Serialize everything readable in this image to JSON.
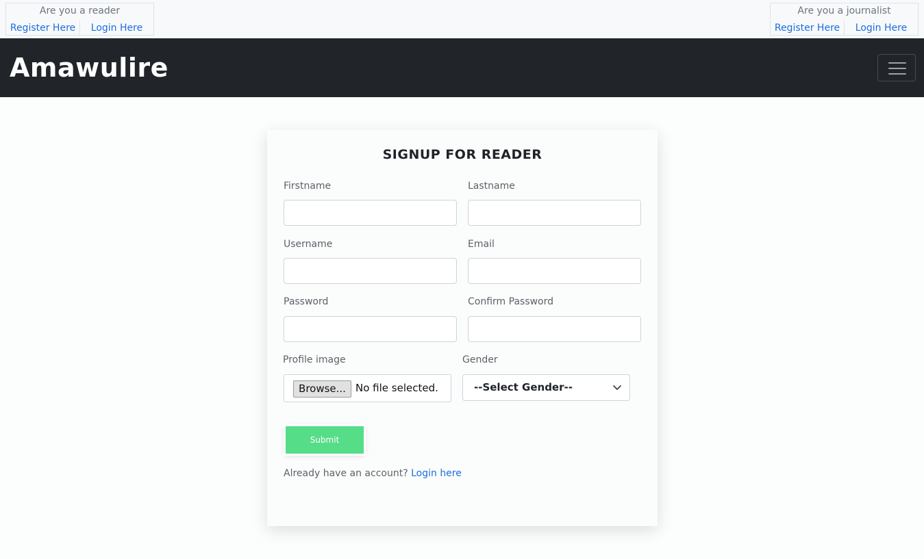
{
  "top_strip": {
    "reader": {
      "title": "Are you a reader",
      "register_label": "Register Here",
      "login_label": "Login Here"
    },
    "journalist": {
      "title": "Are you a journalist",
      "register_label": "Register Here",
      "login_label": "Login Here"
    }
  },
  "navbar": {
    "brand": "Amawulire",
    "toggler_icon": "hamburger-menu-icon"
  },
  "form": {
    "title": "SIGNUP FOR READER",
    "fields": {
      "firstname": {
        "label": "Firstname",
        "value": ""
      },
      "lastname": {
        "label": "Lastname",
        "value": ""
      },
      "username": {
        "label": "Username",
        "value": ""
      },
      "email": {
        "label": "Email",
        "value": ""
      },
      "password": {
        "label": "Password",
        "value": ""
      },
      "confirm_password": {
        "label": "Confirm Password",
        "value": ""
      }
    },
    "profile_image": {
      "label": "Profile image",
      "browse_label": "Browse...",
      "status": "No file selected."
    },
    "gender": {
      "label": "Gender",
      "selected": "--Select Gender--",
      "icon": "chevron-down-icon"
    },
    "submit_label": "Submit",
    "already_text": "Already have an account?",
    "login_link": "Login here"
  },
  "colors": {
    "navbar_bg": "#212529",
    "link": "#1a6fe0",
    "submit_bg": "#55dd88"
  }
}
